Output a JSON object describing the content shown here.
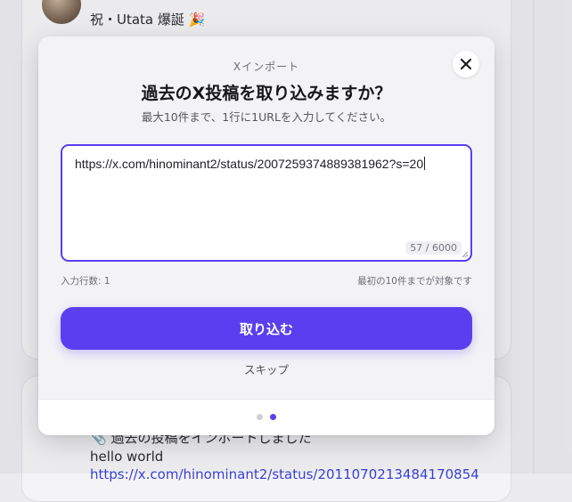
{
  "background": {
    "post_top_title": "祝・Utata 爆誕 🎉",
    "post_bottom_title": "📎 過去の投稿をインポートしました",
    "post_bottom_body": "hello world",
    "post_bottom_link": "https://x.com/hinominant2/status/2011070213484170854"
  },
  "modal": {
    "eyebrow": "Xインポート",
    "title": "過去のX投稿を取り込みますか？",
    "subtitle": "最大10件まで、1行に1URLを入力してください。",
    "input_value": "https://x.com/hinominant2/status/2007259374889381962?s=20",
    "char_counter": "57 / 6000",
    "line_count": "入力行数: 1",
    "limit_note": "最初の10件までが対象です",
    "import_button": "取り込む",
    "skip_link": "スキップ",
    "pagination": {
      "total": 2,
      "current": 2
    }
  },
  "colors": {
    "accent": "#5b3ef0",
    "inactive_dot": "#cfcfd6"
  },
  "icons": {
    "close": "close-icon"
  }
}
